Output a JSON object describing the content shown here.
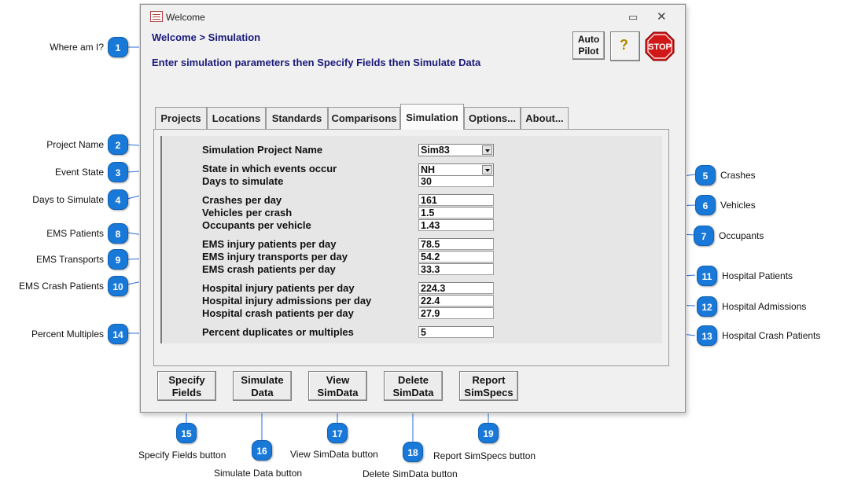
{
  "window": {
    "title": "Welcome",
    "minimize_glyph": "▭",
    "close_glyph": "✕",
    "breadcrumb": "Welcome > Simulation",
    "instruction": "Enter simulation parameters then Specify Fields then Simulate Data",
    "autopilot_line1": "Auto",
    "autopilot_line2": "Pilot",
    "help_icon": "help-icon",
    "help_glyph": "?",
    "stop_label": "STOP"
  },
  "tabs": [
    {
      "label": "Projects"
    },
    {
      "label": "Locations"
    },
    {
      "label": "Standards"
    },
    {
      "label": "Comparisons"
    },
    {
      "label": "Simulation",
      "active": true
    },
    {
      "label": "Options..."
    },
    {
      "label": "About..."
    }
  ],
  "params": {
    "project_name": {
      "label": "Simulation Project Name",
      "value": "Sim83"
    },
    "state": {
      "label": "State in which events occur",
      "value": "NH"
    },
    "days": {
      "label": "Days to simulate",
      "value": "30"
    },
    "crashes": {
      "label": "Crashes per day",
      "value": "161"
    },
    "vehicles": {
      "label": "Vehicles per crash",
      "value": "1.5"
    },
    "occupants": {
      "label": "Occupants per vehicle",
      "value": "1.43"
    },
    "ems_patients": {
      "label": "EMS injury patients per day",
      "value": "78.5"
    },
    "ems_transports": {
      "label": "EMS injury transports per day",
      "value": "54.2"
    },
    "ems_crash": {
      "label": "EMS crash patients per day",
      "value": "33.3"
    },
    "hosp_patients": {
      "label": "Hospital injury patients per day",
      "value": "224.3"
    },
    "hosp_admissions": {
      "label": "Hospital injury admissions per day",
      "value": "22.4"
    },
    "hosp_crash": {
      "label": "Hospital crash patients per day",
      "value": "27.9"
    },
    "pct_multiples": {
      "label": "Percent duplicates or multiples",
      "value": "5"
    }
  },
  "buttons": {
    "specify_fields": {
      "line1": "Specify",
      "line2": "Fields"
    },
    "simulate_data": {
      "line1": "Simulate",
      "line2": "Data"
    },
    "view_simdata": {
      "line1": "View",
      "line2": "SimData"
    },
    "delete_simdata": {
      "line1": "Delete",
      "line2": "SimData"
    },
    "report_simspecs": {
      "line1": "Report",
      "line2": "SimSpecs"
    }
  },
  "callouts": [
    {
      "num": "1",
      "text": "Where am I?"
    },
    {
      "num": "2",
      "text": "Project Name"
    },
    {
      "num": "3",
      "text": "Event State"
    },
    {
      "num": "4",
      "text": "Days to Simulate"
    },
    {
      "num": "5",
      "text": "Crashes"
    },
    {
      "num": "6",
      "text": "Vehicles"
    },
    {
      "num": "7",
      "text": "Occupants"
    },
    {
      "num": "8",
      "text": "EMS Patients"
    },
    {
      "num": "9",
      "text": "EMS Transports"
    },
    {
      "num": "10",
      "text": "EMS Crash Patients"
    },
    {
      "num": "11",
      "text": "Hospital Patients"
    },
    {
      "num": "12",
      "text": "Hospital Admissions"
    },
    {
      "num": "13",
      "text": "Hospital Crash Patients"
    },
    {
      "num": "14",
      "text": "Percent Multiples"
    },
    {
      "num": "15",
      "text": "Specify Fields button"
    },
    {
      "num": "16",
      "text": "Simulate Data button"
    },
    {
      "num": "17",
      "text": "View SimData button"
    },
    {
      "num": "18",
      "text": "Delete SimData button"
    },
    {
      "num": "19",
      "text": "Report SimSpecs button"
    }
  ],
  "colors": {
    "badge": "#1979d8",
    "navy_text": "#1a1a7a",
    "leader_line": "#2a6fd6",
    "stop_red": "#d01818"
  }
}
